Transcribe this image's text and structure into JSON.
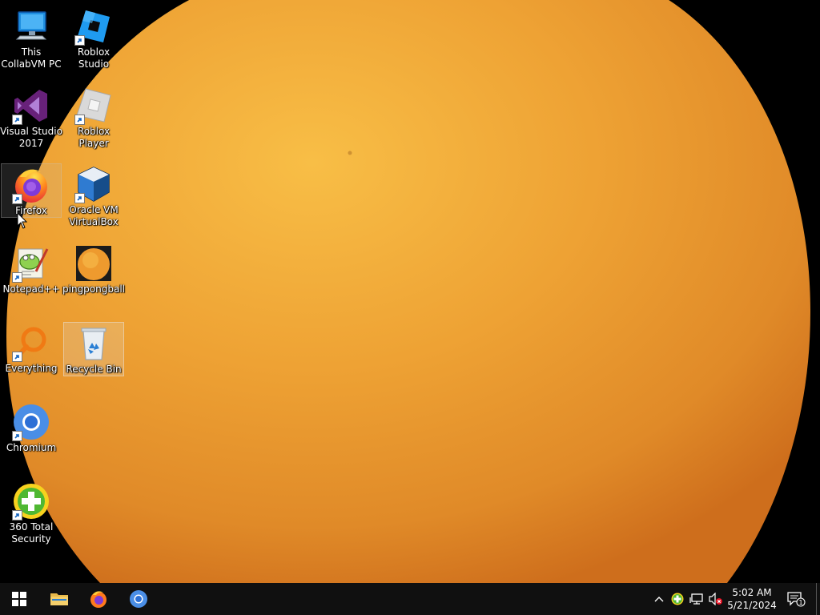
{
  "desktop": {
    "wallpaper": "pingpongball",
    "icons": [
      {
        "label": "This CollabVM PC",
        "icon": "this-pc-icon",
        "shortcut": false
      },
      {
        "label": "Roblox Studio",
        "icon": "roblox-studio-icon",
        "shortcut": true
      },
      {
        "label": "Visual Studio 2017",
        "icon": "visual-studio-icon",
        "shortcut": true
      },
      {
        "label": "Roblox Player",
        "icon": "roblox-player-icon",
        "shortcut": true
      },
      {
        "label": "Firefox",
        "icon": "firefox-icon",
        "shortcut": true,
        "state": "hover"
      },
      {
        "label": "Oracle VM VirtualBox",
        "icon": "virtualbox-icon",
        "shortcut": true
      },
      {
        "label": "Notepad++",
        "icon": "notepad-plus-plus-icon",
        "shortcut": true
      },
      {
        "label": "pingpongball",
        "icon": "image-file-icon",
        "shortcut": false
      },
      {
        "label": "Everything",
        "icon": "everything-search-icon",
        "shortcut": true
      },
      {
        "label": "Recycle Bin",
        "icon": "recycle-bin-icon",
        "shortcut": false,
        "state": "selected"
      },
      {
        "label": "Chromium",
        "icon": "chromium-icon",
        "shortcut": true
      },
      {
        "label": "360 Total Security",
        "icon": "360-total-security-icon",
        "shortcut": true
      }
    ]
  },
  "taskbar": {
    "pinned": [
      {
        "name": "start-button",
        "icon": "windows-logo-icon"
      },
      {
        "name": "file-explorer-button",
        "icon": "folder-icon"
      },
      {
        "name": "firefox-taskbar-button",
        "icon": "firefox-icon"
      },
      {
        "name": "chromium-taskbar-button",
        "icon": "chromium-icon"
      }
    ],
    "tray": {
      "icons": [
        "chevron-up-icon",
        "360-security-tray-icon",
        "network-icon",
        "volume-muted-icon"
      ],
      "time": "5:02 AM",
      "date": "5/21/2024",
      "notification_count": "1"
    }
  },
  "colors": {
    "taskbar": "#101010",
    "ball_light": "#F6B53E",
    "ball_dark": "#D77420",
    "accent": "#1E90FF"
  }
}
